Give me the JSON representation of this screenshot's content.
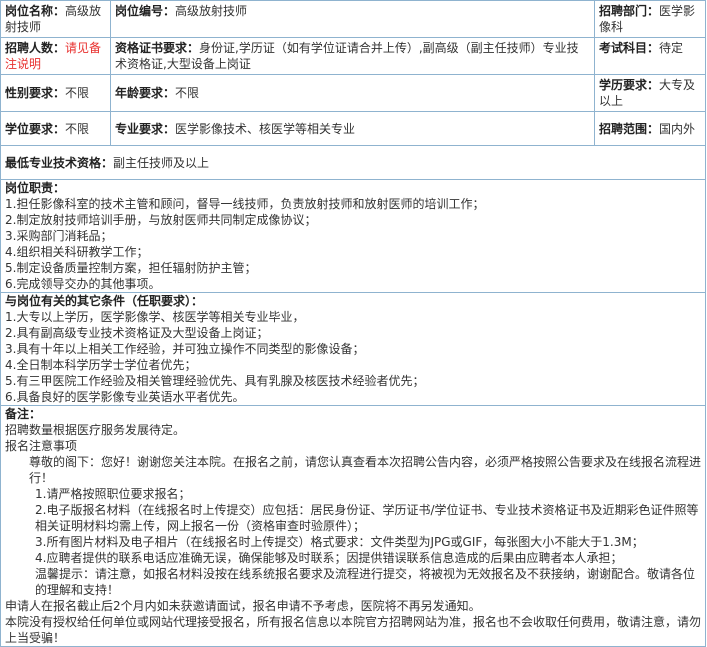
{
  "row1": {
    "title_label": "岗位名称：",
    "title_value": "高级放射技师",
    "code_label": "岗位编号：",
    "code_value": "高级放射技师",
    "dept_label": "招聘部门：",
    "dept_value": "医学影像科"
  },
  "row2": {
    "count_label": "招聘人数：",
    "count_value": "请见备注说明",
    "cert_label": "资格证书要求：",
    "cert_value": "身份证,学历证（如有学位证请合并上传）,副高级（副主任技师）专业技术资格证,大型设备上岗证",
    "exam_label": "考试科目：",
    "exam_value": "待定"
  },
  "row3": {
    "gender_label": "性别要求：",
    "gender_value": "不限",
    "age_label": "年龄要求：",
    "age_value": "不限",
    "edu_label": "学历要求：",
    "edu_value": "大专及以上"
  },
  "row4": {
    "degree_label": "学位要求：",
    "degree_value": "不限",
    "major_label": "专业要求：",
    "major_value": "医学影像技术、核医学等相关专业",
    "scope_label": "招聘范围：",
    "scope_value": "国内外"
  },
  "min_title": {
    "label": "最低专业技术资格：",
    "value": "副主任技师及以上"
  },
  "duties": {
    "title": "岗位职责：",
    "items": [
      "1.担任影像科室的技术主管和顾问，督导一线技师，负责放射技师和放射医师的培训工作；",
      "2.制定放射技师培训手册，与放射医师共同制定成像协议；",
      "3.采购部门消耗品；",
      "4.组织相关科研教学工作；",
      "5.制定设备质量控制方案，担任辐射防护主管；",
      "6.完成领导交办的其他事项。"
    ]
  },
  "conditions": {
    "title": "与岗位有关的其它条件（任职要求）：",
    "items": [
      "1.大专以上学历，医学影像学、核医学等相关专业毕业，",
      "2.具有副高级专业技术资格证及大型设备上岗证；",
      "3.具有十年以上相关工作经验，并可独立操作不同类型的影像设备；",
      "4.全日制本科学历学士学位者优先；",
      "5.有三甲医院工作经验及相关管理经验优先、具有乳腺及核医技术经验者优先；",
      "6.具备良好的医学影像专业英语水平者优先。"
    ]
  },
  "notes": {
    "title": "备注：",
    "line1": "招聘数量根据医疗服务发展待定。",
    "line2": "报名注意事项",
    "para1": "尊敬的阁下：您好！谢谢您关注本院。在报名之前，请您认真查看本次招聘公告内容，必须严格按照公告要求及在线报名流程进行！",
    "item1": "1.请严格按照职位要求报名；",
    "item2": "2.电子版报名材料（在线报名时上传提交）应包括：居民身份证、学历证书/学位证书、专业技术资格证书及近期彩色证件照等相关证明材料均需上传，网上报名一份（资格审查时验原件）；",
    "item3": "3.所有图片材料及电子相片（在线报名时上传提交）格式要求：文件类型为JPG或GIF，每张图大小不能大于1.3M；",
    "item4": "4.应聘者提供的联系电话应准确无误，确保能够及时联系；因提供错误联系信息造成的后果由应聘者本人承担；",
    "tip": "温馨提示：请注意，如报名材料没按在线系统报名要求及流程进行提交，将被视为无效报名及不获接纳，谢谢配合。敬请各位的理解和支持！",
    "line3": "申请人在报名截止后2个月内如未获邀请面试，报名申请不予考虑，医院将不再另发通知。",
    "line4": "本院没有授权给任何单位或网站代理接受报名，所有报名信息以本院官方招聘网站为准，报名也不会收取任何费用，敬请注意，请勿上当受骗！"
  }
}
